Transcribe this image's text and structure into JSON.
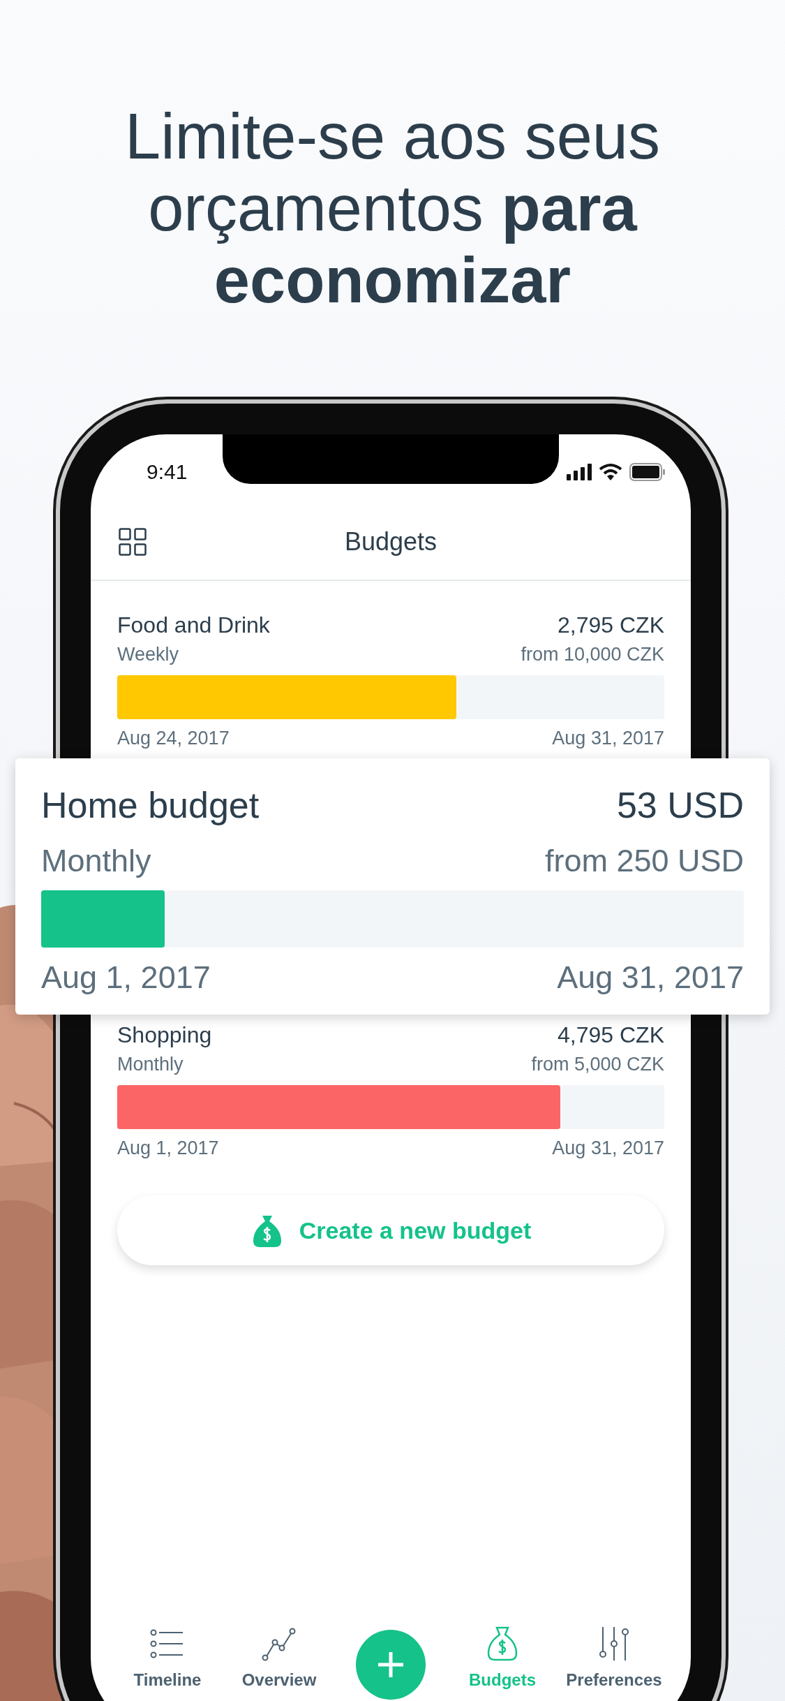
{
  "headline": "Limite-se aos seus orçamentos **para economizar**",
  "status_bar": {
    "time": "9:41"
  },
  "header": {
    "title": "Budgets"
  },
  "budgets": [
    {
      "name": "Food and Drink",
      "amount": "2,795 CZK",
      "period": "Weekly",
      "limit": "from 10,000 CZK",
      "level": 0.62,
      "color": "#ffc800",
      "start": "Aug 24, 2017",
      "end": "Aug 31, 2017",
      "highlighted": false
    },
    {
      "name": "Home budget",
      "amount": "53 USD",
      "period": "Monthly",
      "limit": "from 250 USD",
      "level": 0.176,
      "color": "#14c28a",
      "start": "Aug 1, 2017",
      "end": "Aug 31, 2017",
      "highlighted": true
    },
    {
      "name": "Shopping",
      "amount": "4,795 CZK",
      "period": "Monthly",
      "limit": "from 5,000 CZK",
      "level": 0.81,
      "color": "#fc6565",
      "start": "Aug 1, 2017",
      "end": "Aug 31, 2017",
      "highlighted": false
    }
  ],
  "create_button": {
    "label": "Create a new budget"
  },
  "tab_bar": [
    {
      "label": "Timeline",
      "kind": "timeline",
      "selected": false
    },
    {
      "label": "Overview",
      "kind": "overview",
      "selected": false
    },
    {
      "label": "Budgets",
      "kind": "budgets",
      "selected": true
    },
    {
      "label": "Preferences",
      "kind": "preferences",
      "selected": false
    }
  ]
}
